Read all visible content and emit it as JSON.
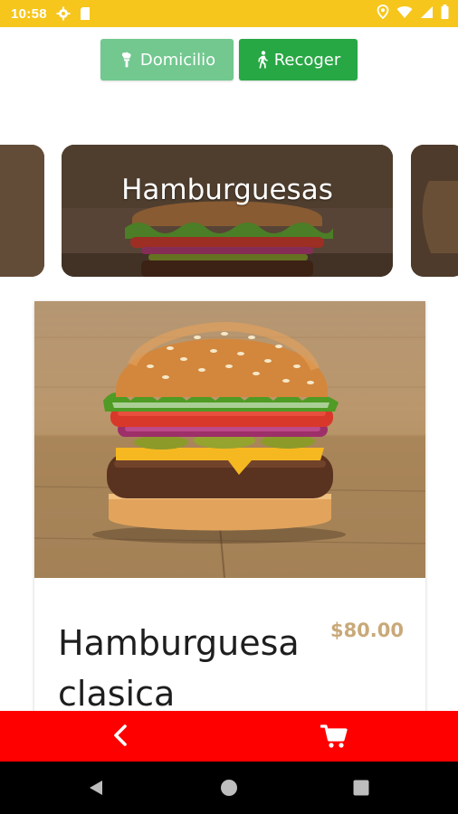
{
  "status_bar": {
    "time": "10:58",
    "left_icons": [
      "gear-icon",
      "sim-card-icon"
    ],
    "right_icons": [
      "location-icon",
      "wifi-icon",
      "signal-icon",
      "battery-icon"
    ],
    "color": "#f6c61c"
  },
  "delivery_toggle": {
    "domicilio_label": "Domicilio",
    "domicilio_icon": "delivery-icon",
    "recoger_label": "Recoger",
    "recoger_icon": "walking-icon",
    "domicilio_color": "#72c88f",
    "recoger_color": "#28a745"
  },
  "categories": {
    "active_label": "Hamburguesas"
  },
  "product": {
    "name": "Hamburguesa clasica",
    "price": "$80.00",
    "price_color": "#c9a979"
  },
  "action_bar": {
    "color": "#ff0000",
    "back_icon": "chevron-left-icon",
    "cart_icon": "cart-icon"
  },
  "system_nav": {
    "icons": [
      "back-triangle-icon",
      "home-circle-icon",
      "recents-square-icon"
    ]
  }
}
